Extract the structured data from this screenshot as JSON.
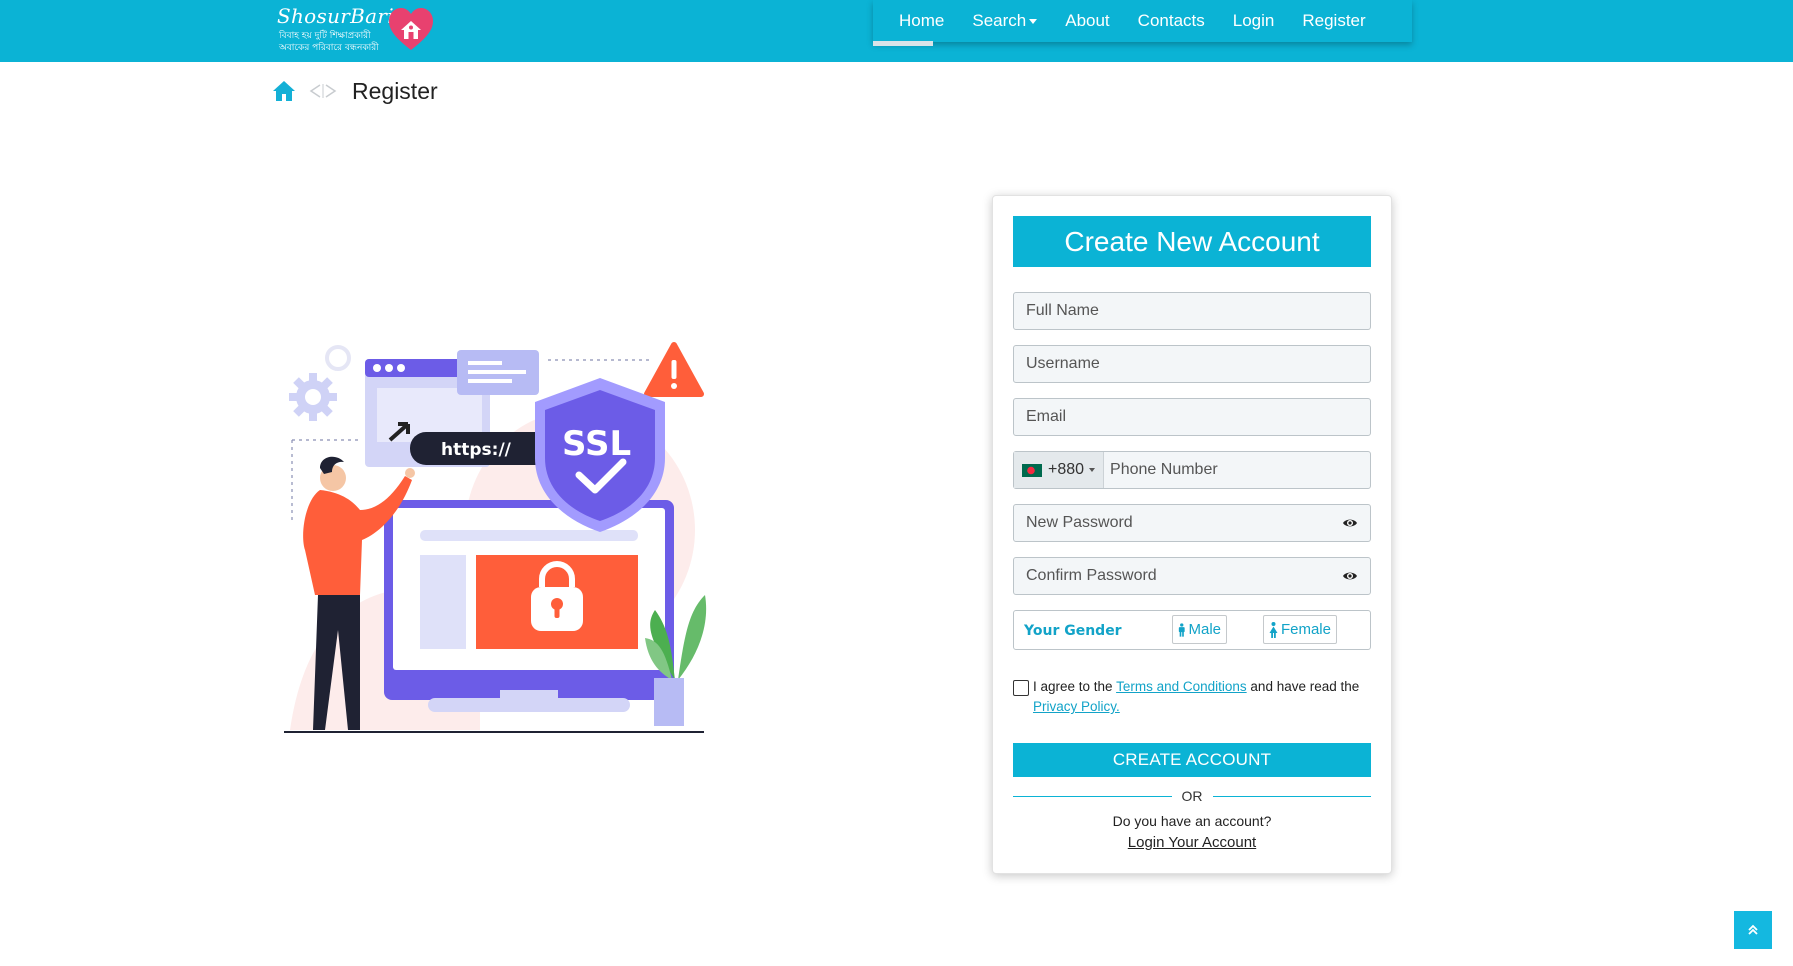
{
  "brand": {
    "name": "ShosurBari",
    "tagline_line1": "বিবাহ হয় দুটি শিক্ষাপ্রকারী",
    "tagline_line2": "অবাকের পরিবারে বন্ধনকারী",
    "icon": "heart-house-logo"
  },
  "nav": {
    "items": [
      "Home",
      "Search",
      "About",
      "Contacts",
      "Login",
      "Register"
    ],
    "active": "Home"
  },
  "breadcrumb": {
    "home_icon": "home-icon",
    "separator_icon": "angle-separator-icon",
    "current": "Register"
  },
  "illustration": {
    "url_text": "https://",
    "badge_text": "SSL"
  },
  "form": {
    "title": "Create New Account",
    "full_name_placeholder": "Full Name",
    "username_placeholder": "Username",
    "email_placeholder": "Email",
    "country_code": "+880",
    "phone_placeholder": "Phone Number",
    "new_password_placeholder": "New Password",
    "confirm_password_placeholder": "Confirm Password",
    "gender_label": "Your Gender",
    "gender_male": "Male",
    "gender_female": "Female",
    "agree_prefix": "I agree to the",
    "terms_link": "Terms and Conditions",
    "agree_middle": "and have read the",
    "privacy_link": "Privacy Policy.",
    "submit_label": "CREATE ACCOUNT",
    "or_label": "OR",
    "have_account": "Do you have an account?",
    "login_link": "Login Your Account"
  },
  "colors": {
    "primary": "#0bb3d5",
    "accent_orange": "#ff5e3a",
    "accent_purple": "#6c5ce7"
  }
}
